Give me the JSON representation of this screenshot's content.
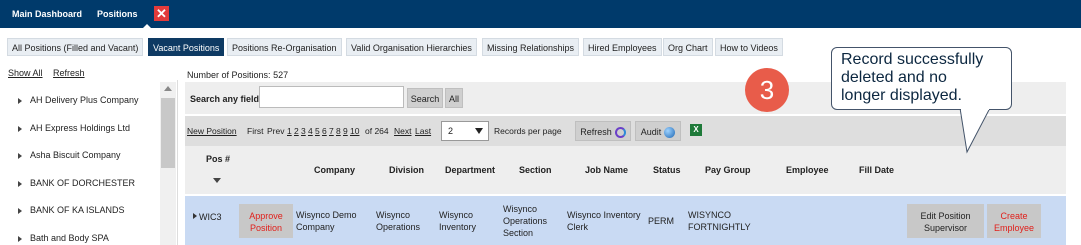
{
  "topbar": {
    "main_dashboard": "Main Dashboard",
    "positions": "Positions",
    "close_glyph": "✕"
  },
  "tabs": [
    {
      "label": "All Positions (Filled and Vacant)",
      "active": false
    },
    {
      "label": "Vacant Positions",
      "active": true
    },
    {
      "label": "Positions Re-Organisation",
      "active": false
    },
    {
      "label": "Valid Organisation Hierarchies",
      "active": false
    },
    {
      "label": "Missing Relationships",
      "active": false
    },
    {
      "label": "Hired Employees",
      "active": false
    },
    {
      "label": "Org Chart",
      "active": false
    },
    {
      "label": "How to Videos",
      "active": false
    }
  ],
  "sidebar": {
    "show_all": "Show All",
    "refresh": "Refresh",
    "items": [
      "AH Delivery Plus Company",
      "AH Express Holdings Ltd",
      "Asha Biscuit Company",
      "BANK OF DORCHESTER",
      "BANK OF KA ISLANDS",
      "Bath and Body SPA"
    ]
  },
  "summary": {
    "number_label": "Number of Positions:",
    "number_value": "527"
  },
  "search": {
    "label": "Search any field:",
    "value": "",
    "search_button": "Search",
    "all_button": "All"
  },
  "pager": {
    "new_position": "New Position",
    "first": "First",
    "prev": "Prev",
    "pages": [
      "1",
      "2",
      "3",
      "4",
      "5",
      "6",
      "7",
      "8",
      "9",
      "10"
    ],
    "of_text": "of 264",
    "next": "Next",
    "last": "Last",
    "per_page_value": "2",
    "per_page_label": "Records per page",
    "refresh_button": "Refresh",
    "audit_button": "Audit",
    "excel_glyph": "X"
  },
  "table": {
    "headers": {
      "pos": "Pos #",
      "company": "Company",
      "division": "Division",
      "department": "Department",
      "section": "Section",
      "job_name": "Job Name",
      "status": "Status",
      "pay_group": "Pay Group",
      "employee": "Employee",
      "fill_date": "Fill Date"
    },
    "rows": [
      {
        "pos": "WIC3",
        "approve_l1": "Approve",
        "approve_l2": "Position",
        "company_l1": "Wisynco Demo",
        "company_l2": "Company",
        "division_l1": "Wisynco",
        "division_l2": "Operations",
        "department_l1": "Wisynco",
        "department_l2": "Inventory",
        "section_l1": "Wisynco",
        "section_l2": "Operations",
        "section_l3": "Section",
        "job_l1": "Wisynco Inventory",
        "job_l2": "Clerk",
        "status": "PERM",
        "pay_group_l1": "WISYNCO",
        "pay_group_l2": "FORTNIGHTLY",
        "edit_l1": "Edit Position",
        "edit_l2": "Supervisor",
        "create_l1": "Create",
        "create_l2": "Employee"
      }
    ]
  },
  "annotation": {
    "step": "3",
    "line1": "Record successfully",
    "line2": "deleted and no",
    "line3": "longer displayed."
  },
  "colors": {
    "topbar": "#003a6b",
    "active_tab": "#0e3a63",
    "row_highlight": "#c9daf3",
    "danger_text": "#e0201b",
    "badge": "#e85c4a"
  }
}
